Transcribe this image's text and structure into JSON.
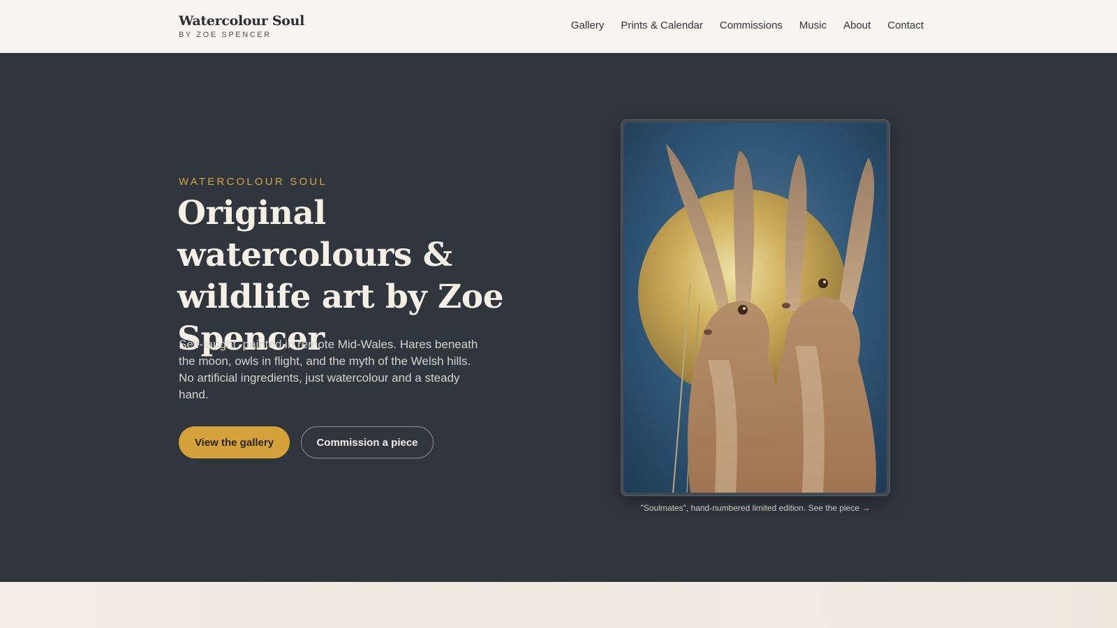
{
  "header": {
    "brand_title": "Watercolour Soul",
    "brand_subtitle": "BY ZOE SPENCER",
    "nav": [
      "Gallery",
      "Prints & Calendar",
      "Commissions",
      "Music",
      "About",
      "Contact"
    ]
  },
  "hero": {
    "eyebrow": "WATERCOLOUR SOUL",
    "headline": "Original watercolours & wildlife art by Zoe Spencer",
    "lede": "Self-taught, painted in remote Mid-Wales. Hares beneath the moon, owls in flight, and the myth of the Welsh hills. No artificial ingredients, just watercolour and a steady hand.",
    "primary_cta": "View the gallery",
    "secondary_cta": "Commission a piece",
    "caption_text": "\"Soulmates\", hand-numbered limited edition. ",
    "caption_link": "See the piece →"
  },
  "colors": {
    "accent": "#d4a13a",
    "hero_bg": "#2f363d",
    "header_bg": "#f8f5f0",
    "eyebrow": "#d9a441"
  },
  "icons": [
    "arrow-right-icon"
  ]
}
